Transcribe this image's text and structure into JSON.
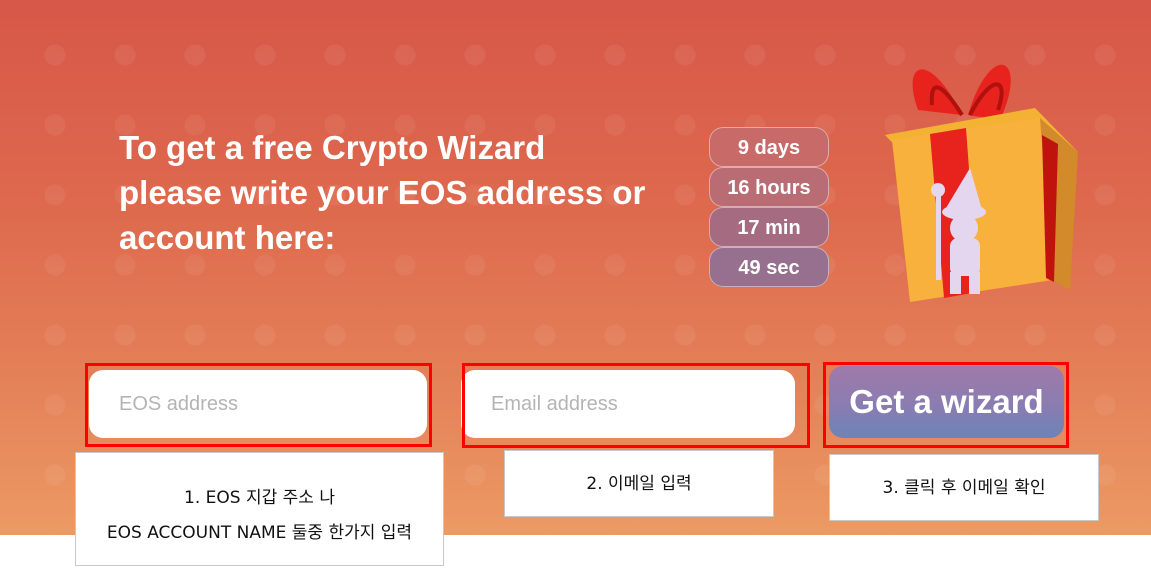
{
  "headline": {
    "line1": "To get a free Crypto Wizard",
    "line2": "please write your EOS address or",
    "line3": "account here:"
  },
  "timer": {
    "days": "9 days",
    "hours": "16 hours",
    "minutes": "17 min",
    "seconds": "49 sec"
  },
  "form": {
    "eos_placeholder": "EOS address",
    "email_placeholder": "Email address",
    "submit_label": "Get a wizard"
  },
  "annotations": {
    "step1_line1": "1. EOS 지갑 주소 나",
    "step1_line2": "EOS ACCOUNT NAME 둘중 한가지 입력",
    "step2": "2. 이메일 입력",
    "step3": "3. 클릭 후 이메일 확인"
  },
  "colors": {
    "highlight": "#ff0000",
    "button": "#8a7cb1",
    "banner_top": "#d75748",
    "banner_bottom": "#ec9a64"
  },
  "icons": {
    "gift": "gift-box-icon",
    "wizard": "wizard-silhouette-icon"
  }
}
